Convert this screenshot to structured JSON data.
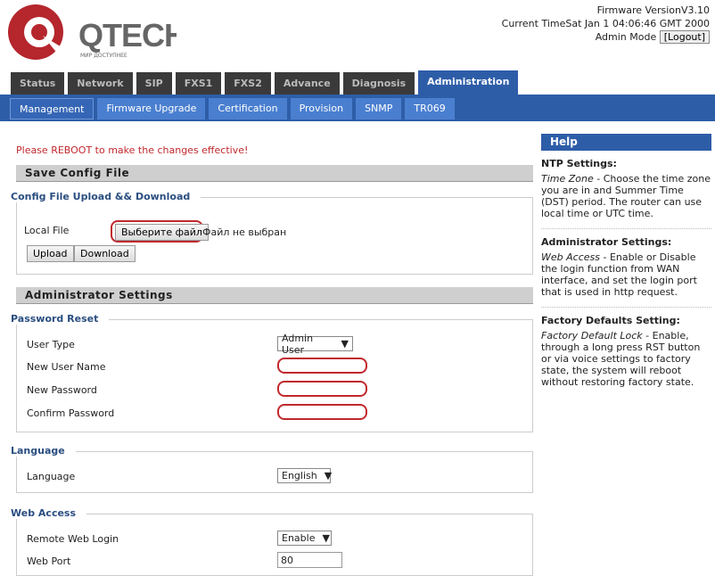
{
  "brand": {
    "name": "QTECH",
    "tagline": "МИР ДОСТУПНЕЕ",
    "color": "#b5262d"
  },
  "header": {
    "firmware": "Firmware VersionV3.10",
    "time": "Current TimeSat Jan 1 04:06:46 GMT 2000",
    "mode": "Admin Mode",
    "logout": "[Logout]"
  },
  "tabs": [
    "Status",
    "Network",
    "SIP",
    "FXS1",
    "FXS2",
    "Advance",
    "Diagnosis",
    "Administration"
  ],
  "subtabs": [
    "Management",
    "Firmware Upgrade",
    "Certification",
    "Provision",
    "SNMP",
    "TR069"
  ],
  "main": {
    "reboot": "Please REBOOT to make the changes effective!",
    "save_config": "Save Config File",
    "upload_legend": "Config File Upload && Download",
    "local_file": "Local File",
    "choose_file": "Выберите файл",
    "no_file": "Файл не выбран",
    "upload": "Upload",
    "download": "Download",
    "admin_settings": "Administrator Settings",
    "pw_legend": "Password Reset",
    "user_type": "User Type",
    "user_type_value": "Admin User",
    "new_user": "New User Name",
    "new_pw": "New Password",
    "confirm_pw": "Confirm Password",
    "lang_legend": "Language",
    "language": "Language",
    "language_value": "English",
    "web_legend": "Web Access",
    "remote": "Remote Web Login",
    "remote_value": "Enable",
    "web_port": "Web Port",
    "web_port_value": "80"
  },
  "help": {
    "title": "Help",
    "sections": [
      {
        "title": "NTP Settings:",
        "term": "Time Zone",
        "text": " - Choose the time zone you are in and Summer Time (DST) period. The router can use local time or UTC time."
      },
      {
        "title": "Administrator Settings:",
        "term": "Web Access",
        "text": " - Enable or Disable the login function from WAN interface, and set the login port that is used in http request."
      },
      {
        "title": "Factory Defaults Setting:",
        "term": "Factory Default Lock",
        "text": " - Enable, through a long press RST button or via voice settings to factory state, the system will reboot without restoring factory state."
      }
    ]
  }
}
